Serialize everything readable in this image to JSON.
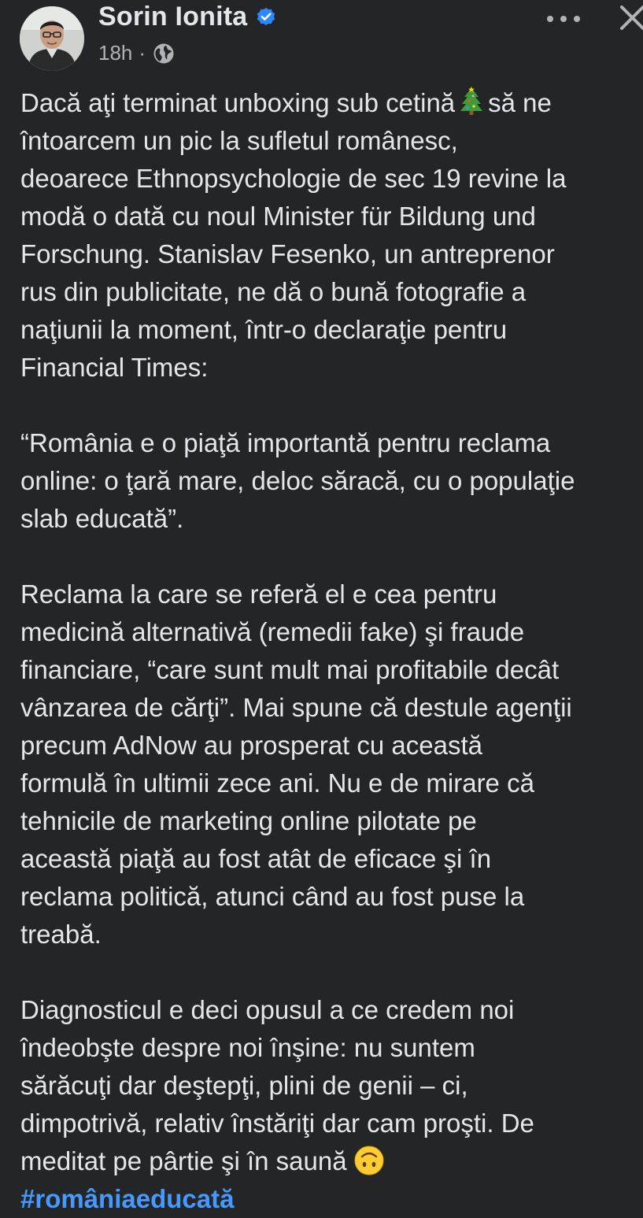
{
  "post": {
    "author_name": "Sorin Ionita",
    "timestamp": "18h",
    "separator": "·",
    "audience_icon": "globe-icon",
    "verified_icon": "verified-badge-icon",
    "lines": {
      "l1a": "Dacă aţi terminat unboxing sub cetină",
      "l1b": "să ne",
      "l2": "întoarcem un pic la sufletul românesc,",
      "l3": "deoarece Ethnopsychologie de sec 19 revine la",
      "l4": "modă o dată cu noul Minister für Bildung und",
      "l5": "Forschung. Stanislav Fesenko, un antreprenor",
      "l6": "rus din publicitate, ne dă o bună fotografie a",
      "l7": "naţiunii la moment, într-o declaraţie pentru",
      "l8": "Financial Times:",
      "l9": "“România e o piaţă importantă pentru reclama",
      "l10": "online: o ţară mare, deloc săracă, cu o populaţie",
      "l11": "slab educată”.",
      "l12": "Reclama la care se referă el e cea pentru",
      "l13": "medicină alternativă (remedii fake) şi fraude",
      "l14": "financiare, “care sunt mult mai profitabile decât",
      "l15": "vânzarea de cărţi”. Mai spune că destule agenţii",
      "l16": "precum AdNow au prosperat cu această",
      "l17": "formulă în ultimii zece ani. Nu e de mirare că",
      "l18": "tehnicile de marketing online pilotate pe",
      "l19": "această piaţă au fost atât de eficace şi în",
      "l20": "reclama politică, atunci când au fost puse la",
      "l21": "treabă.",
      "l22": "Diagnosticul e deci opusul a ce credem noi",
      "l23": "îndeobşte despre noi înşine: nu suntem",
      "l24": "sărăcuţi dar deştepţi, plini de genii – ci,",
      "l25": "dimpotrivă, relativ înstăriţi dar cam proşti. De",
      "l26": "meditat pe pârtie şi în saună"
    },
    "hashtag": "#româniaeducată",
    "emojis": [
      "christmas-tree-icon",
      "upside-down-face-icon"
    ]
  },
  "colors": {
    "background": "#242526",
    "text": "#e4e6eb",
    "secondary_text": "#b0b3b8",
    "link": "#4599ff",
    "verified": "#2d88ff"
  }
}
